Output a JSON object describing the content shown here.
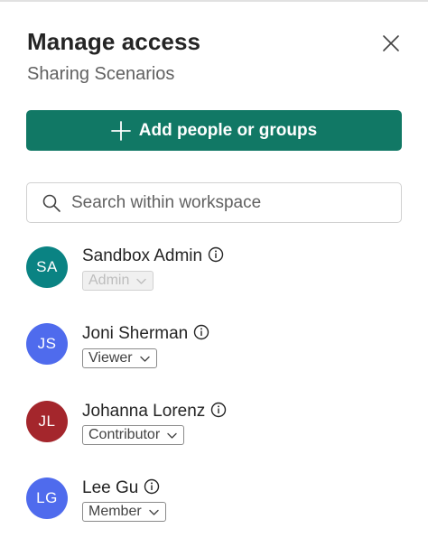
{
  "panel": {
    "title": "Manage access",
    "subtitle": "Sharing Scenarios",
    "close_icon": "close-icon"
  },
  "add_button": {
    "label": "Add people or groups",
    "icon": "plus-icon",
    "color": "#117865"
  },
  "search": {
    "placeholder": "Search within workspace",
    "value": "",
    "icon": "search-icon"
  },
  "members": [
    {
      "initials": "SA",
      "name": "Sandbox Admin",
      "role": "Admin",
      "role_disabled": true,
      "avatar_color": "#0a8383"
    },
    {
      "initials": "JS",
      "name": "Joni Sherman",
      "role": "Viewer",
      "role_disabled": false,
      "avatar_color": "#4f6bed"
    },
    {
      "initials": "JL",
      "name": "Johanna Lorenz",
      "role": "Contributor",
      "role_disabled": false,
      "avatar_color": "#a4262c"
    },
    {
      "initials": "LG",
      "name": "Lee Gu",
      "role": "Member",
      "role_disabled": false,
      "avatar_color": "#4f6bed"
    }
  ]
}
